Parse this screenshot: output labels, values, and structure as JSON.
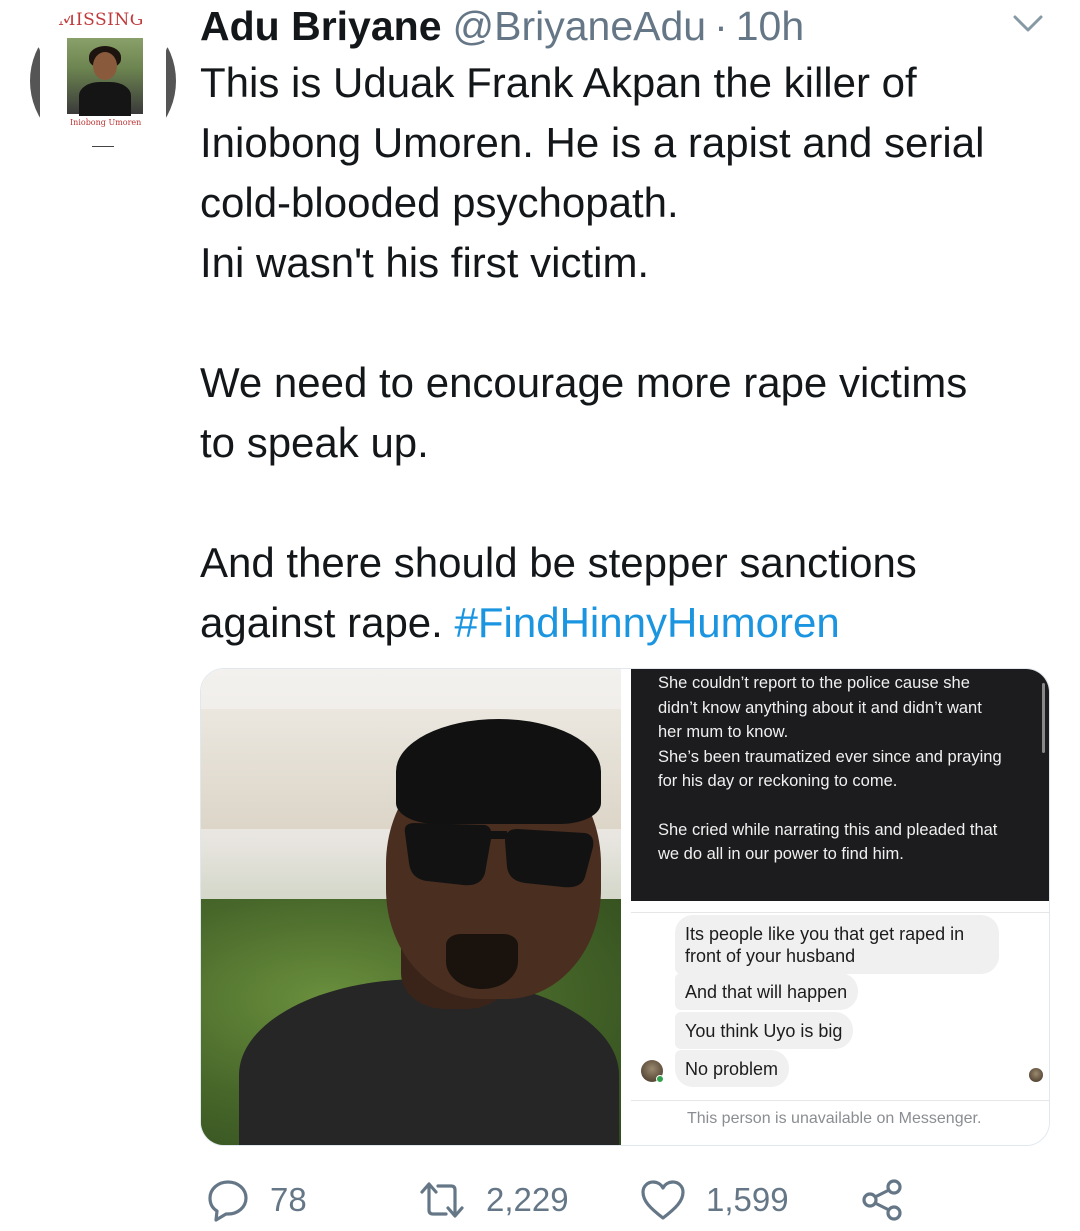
{
  "avatar": {
    "banner_text": "MISSING",
    "name_text": "Iniobong Umoren"
  },
  "header": {
    "display_name": "Adu Briyane",
    "handle": "@BriyaneAdu",
    "separator": "·",
    "time": "10h"
  },
  "tweet": {
    "paragraph1_lines": [
      "This is Uduak Frank Akpan the killer of",
      "Iniobong Umoren. He is a rapist and serial",
      "cold-blooded psychopath.",
      "Ini wasn't his first victim."
    ],
    "paragraph2_lines": [
      "We need to encourage more rape victims",
      "to speak up."
    ],
    "paragraph3_line1": "And there should be stepper sanctions",
    "paragraph3_line2_prefix": "against rape. ",
    "hashtag": "#FindHinnyHumoren"
  },
  "media": {
    "dark_chat": {
      "line1": "She couldn’t report to the police cause she",
      "line2": "didn’t know anything about it and didn’t want",
      "line3": "her mum to know.",
      "line4": "She’s been traumatized ever since and praying",
      "line5": "for his day or reckoning to come.",
      "line6": "She cried while narrating this and pleaded that",
      "line7": "we do all in our power to find him."
    },
    "messenger": {
      "bubble1": "Its people like you that get raped in front of your husband",
      "bubble2": "And that will happen",
      "bubble3": "You think Uyo is big",
      "bubble4": "No problem",
      "unavailable": "This person is unavailable on Messenger."
    }
  },
  "actions": {
    "reply_count": "78",
    "retweet_count": "2,229",
    "like_count": "1,599",
    "icons": [
      "reply-icon",
      "retweet-icon",
      "like-icon",
      "share-icon"
    ],
    "icon_color": "#657786"
  },
  "colors": {
    "text": "#14171a",
    "secondary": "#657786",
    "link": "#1b95e0"
  }
}
